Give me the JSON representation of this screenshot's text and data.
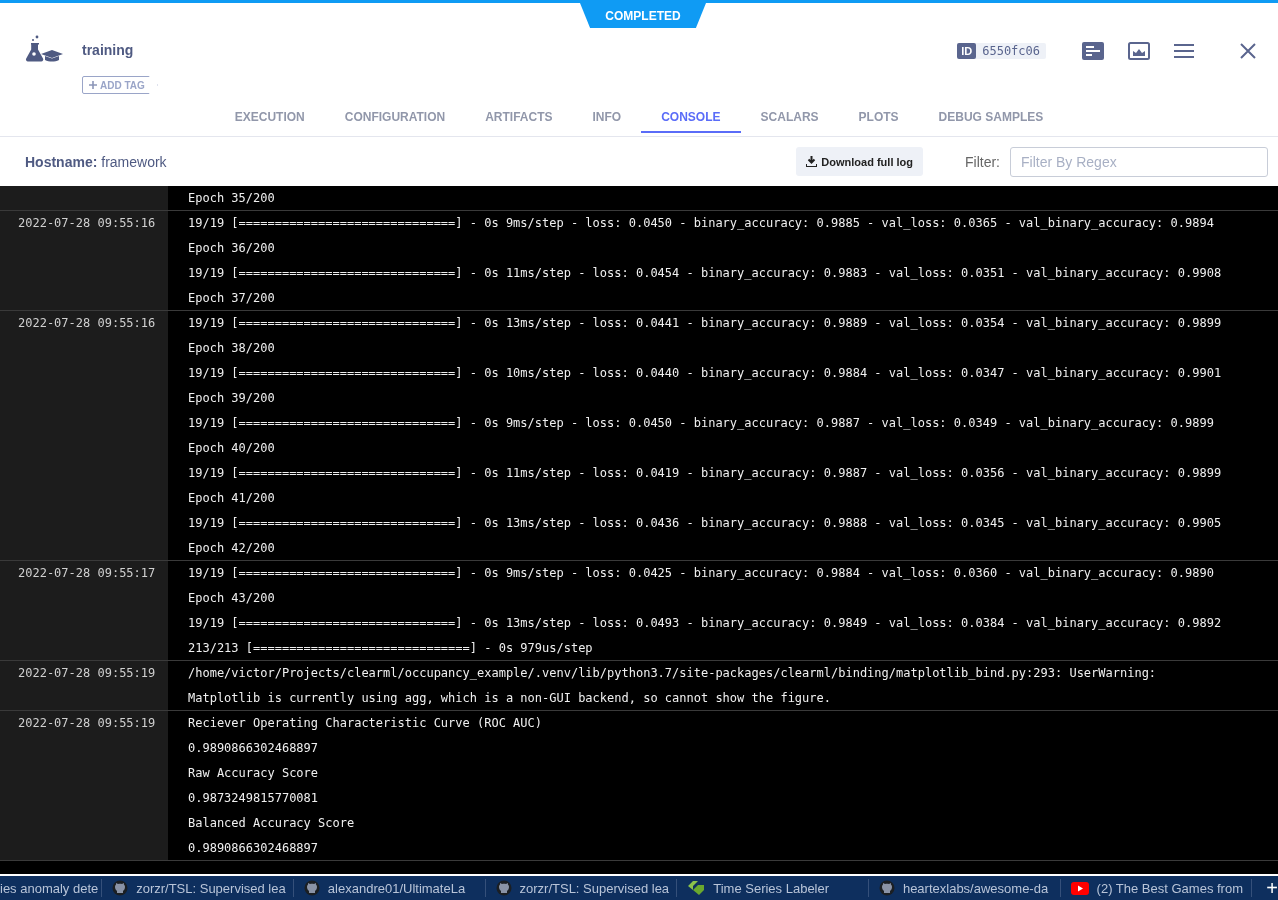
{
  "header": {
    "status": "COMPLETED",
    "title": "training",
    "add_tag": "ADD TAG",
    "id_label": "ID",
    "id": "6550fc06"
  },
  "tabs": [
    {
      "label": "EXECUTION",
      "selected": false
    },
    {
      "label": "CONFIGURATION",
      "selected": false
    },
    {
      "label": "ARTIFACTS",
      "selected": false
    },
    {
      "label": "INFO",
      "selected": false
    },
    {
      "label": "CONSOLE",
      "selected": true
    },
    {
      "label": "SCALARS",
      "selected": false
    },
    {
      "label": "PLOTS",
      "selected": false
    },
    {
      "label": "DEBUG SAMPLES",
      "selected": false
    }
  ],
  "toolbar": {
    "hostname_label": "Hostname:",
    "hostname": "framework",
    "download_button": "Download full log",
    "filter_label": "Filter:",
    "filter_placeholder": "Filter By Regex"
  },
  "log": [
    {
      "lines": [
        "Epoch 35/200"
      ]
    },
    {
      "timestamp": "2022-07-28 09:55:16",
      "lines": [
        "19/19 [==============================] - 0s 9ms/step - loss: 0.0450 - binary_accuracy: 0.9885 - val_loss: 0.0365 - val_binary_accuracy: 0.9894",
        "Epoch 36/200",
        "19/19 [==============================] - 0s 11ms/step - loss: 0.0454 - binary_accuracy: 0.9883 - val_loss: 0.0351 - val_binary_accuracy: 0.9908",
        "Epoch 37/200"
      ]
    },
    {
      "timestamp": "2022-07-28 09:55:16",
      "lines": [
        "19/19 [==============================] - 0s 13ms/step - loss: 0.0441 - binary_accuracy: 0.9889 - val_loss: 0.0354 - val_binary_accuracy: 0.9899",
        "Epoch 38/200",
        "19/19 [==============================] - 0s 10ms/step - loss: 0.0440 - binary_accuracy: 0.9884 - val_loss: 0.0347 - val_binary_accuracy: 0.9901",
        "Epoch 39/200",
        "19/19 [==============================] - 0s 9ms/step - loss: 0.0450 - binary_accuracy: 0.9887 - val_loss: 0.0349 - val_binary_accuracy: 0.9899",
        "Epoch 40/200",
        "19/19 [==============================] - 0s 11ms/step - loss: 0.0419 - binary_accuracy: 0.9887 - val_loss: 0.0356 - val_binary_accuracy: 0.9899",
        "Epoch 41/200",
        "19/19 [==============================] - 0s 13ms/step - loss: 0.0436 - binary_accuracy: 0.9888 - val_loss: 0.0345 - val_binary_accuracy: 0.9905",
        "Epoch 42/200"
      ]
    },
    {
      "timestamp": "2022-07-28 09:55:17",
      "lines": [
        "19/19 [==============================] - 0s 9ms/step - loss: 0.0425 - binary_accuracy: 0.9884 - val_loss: 0.0360 - val_binary_accuracy: 0.9890",
        "Epoch 43/200",
        "19/19 [==============================] - 0s 13ms/step - loss: 0.0493 - binary_accuracy: 0.9849 - val_loss: 0.0384 - val_binary_accuracy: 0.9892",
        "213/213 [==============================] - 0s 979us/step"
      ]
    },
    {
      "timestamp": "2022-07-28 09:55:19",
      "lines": [
        "/home/victor/Projects/clearml/occupancy_example/.venv/lib/python3.7/site-packages/clearml/binding/matplotlib_bind.py:293: UserWarning:",
        "Matplotlib is currently using agg, which is a non-GUI backend, so cannot show the figure."
      ]
    },
    {
      "timestamp": "2022-07-28 09:55:19",
      "lines": [
        "Reciever Operating Characteristic Curve (ROC AUC)",
        "0.9890866302468897",
        "Raw Accuracy Score",
        "0.9873249815770081",
        "Balanced Accuracy Score",
        "0.9890866302468897"
      ]
    }
  ],
  "browser_tabs": [
    {
      "title": "ies anomaly dete",
      "kind": "plain"
    },
    {
      "title": "zorzr/TSL: Supervised lea",
      "kind": "github"
    },
    {
      "title": "alexandre01/UltimateLa",
      "kind": "github"
    },
    {
      "title": "zorzr/TSL: Supervised lea",
      "kind": "github"
    },
    {
      "title": "Time Series Labeler",
      "kind": "labels"
    },
    {
      "title": "heartexlabs/awesome-da",
      "kind": "github"
    },
    {
      "title": "(2) The Best Games from",
      "kind": "video"
    }
  ],
  "new_tab": "+"
}
